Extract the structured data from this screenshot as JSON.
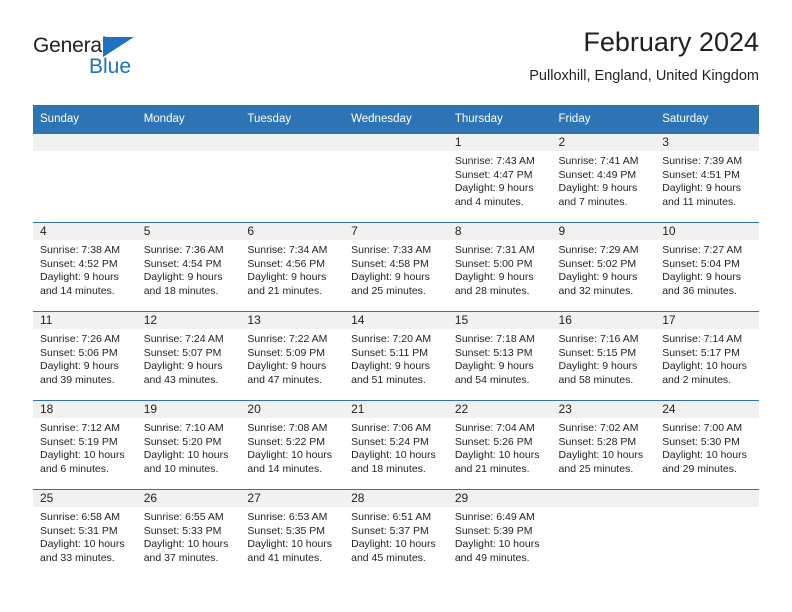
{
  "logo": {
    "word1": "General",
    "word2": "Blue",
    "triangle_color": "#1f72bd",
    "icon": "triangle-icon"
  },
  "header": {
    "title": "February 2024",
    "subtitle": "Pulloxhill, England, United Kingdom"
  },
  "theme": {
    "header_blue": "#2e74b5",
    "daynum_band": "#f1f1f1",
    "text": "#231f20"
  },
  "calendar": {
    "weekday_headers": [
      "Sunday",
      "Monday",
      "Tuesday",
      "Wednesday",
      "Thursday",
      "Friday",
      "Saturday"
    ],
    "weeks": [
      [
        {
          "day": "",
          "lines": []
        },
        {
          "day": "",
          "lines": []
        },
        {
          "day": "",
          "lines": []
        },
        {
          "day": "",
          "lines": []
        },
        {
          "day": "1",
          "lines": [
            "Sunrise: 7:43 AM",
            "Sunset: 4:47 PM",
            "Daylight: 9 hours",
            "and 4 minutes."
          ]
        },
        {
          "day": "2",
          "lines": [
            "Sunrise: 7:41 AM",
            "Sunset: 4:49 PM",
            "Daylight: 9 hours",
            "and 7 minutes."
          ]
        },
        {
          "day": "3",
          "lines": [
            "Sunrise: 7:39 AM",
            "Sunset: 4:51 PM",
            "Daylight: 9 hours",
            "and 11 minutes."
          ]
        }
      ],
      [
        {
          "day": "4",
          "lines": [
            "Sunrise: 7:38 AM",
            "Sunset: 4:52 PM",
            "Daylight: 9 hours",
            "and 14 minutes."
          ]
        },
        {
          "day": "5",
          "lines": [
            "Sunrise: 7:36 AM",
            "Sunset: 4:54 PM",
            "Daylight: 9 hours",
            "and 18 minutes."
          ]
        },
        {
          "day": "6",
          "lines": [
            "Sunrise: 7:34 AM",
            "Sunset: 4:56 PM",
            "Daylight: 9 hours",
            "and 21 minutes."
          ]
        },
        {
          "day": "7",
          "lines": [
            "Sunrise: 7:33 AM",
            "Sunset: 4:58 PM",
            "Daylight: 9 hours",
            "and 25 minutes."
          ]
        },
        {
          "day": "8",
          "lines": [
            "Sunrise: 7:31 AM",
            "Sunset: 5:00 PM",
            "Daylight: 9 hours",
            "and 28 minutes."
          ]
        },
        {
          "day": "9",
          "lines": [
            "Sunrise: 7:29 AM",
            "Sunset: 5:02 PM",
            "Daylight: 9 hours",
            "and 32 minutes."
          ]
        },
        {
          "day": "10",
          "lines": [
            "Sunrise: 7:27 AM",
            "Sunset: 5:04 PM",
            "Daylight: 9 hours",
            "and 36 minutes."
          ]
        }
      ],
      [
        {
          "day": "11",
          "lines": [
            "Sunrise: 7:26 AM",
            "Sunset: 5:06 PM",
            "Daylight: 9 hours",
            "and 39 minutes."
          ]
        },
        {
          "day": "12",
          "lines": [
            "Sunrise: 7:24 AM",
            "Sunset: 5:07 PM",
            "Daylight: 9 hours",
            "and 43 minutes."
          ]
        },
        {
          "day": "13",
          "lines": [
            "Sunrise: 7:22 AM",
            "Sunset: 5:09 PM",
            "Daylight: 9 hours",
            "and 47 minutes."
          ]
        },
        {
          "day": "14",
          "lines": [
            "Sunrise: 7:20 AM",
            "Sunset: 5:11 PM",
            "Daylight: 9 hours",
            "and 51 minutes."
          ]
        },
        {
          "day": "15",
          "lines": [
            "Sunrise: 7:18 AM",
            "Sunset: 5:13 PM",
            "Daylight: 9 hours",
            "and 54 minutes."
          ]
        },
        {
          "day": "16",
          "lines": [
            "Sunrise: 7:16 AM",
            "Sunset: 5:15 PM",
            "Daylight: 9 hours",
            "and 58 minutes."
          ]
        },
        {
          "day": "17",
          "lines": [
            "Sunrise: 7:14 AM",
            "Sunset: 5:17 PM",
            "Daylight: 10 hours",
            "and 2 minutes."
          ]
        }
      ],
      [
        {
          "day": "18",
          "lines": [
            "Sunrise: 7:12 AM",
            "Sunset: 5:19 PM",
            "Daylight: 10 hours",
            "and 6 minutes."
          ]
        },
        {
          "day": "19",
          "lines": [
            "Sunrise: 7:10 AM",
            "Sunset: 5:20 PM",
            "Daylight: 10 hours",
            "and 10 minutes."
          ]
        },
        {
          "day": "20",
          "lines": [
            "Sunrise: 7:08 AM",
            "Sunset: 5:22 PM",
            "Daylight: 10 hours",
            "and 14 minutes."
          ]
        },
        {
          "day": "21",
          "lines": [
            "Sunrise: 7:06 AM",
            "Sunset: 5:24 PM",
            "Daylight: 10 hours",
            "and 18 minutes."
          ]
        },
        {
          "day": "22",
          "lines": [
            "Sunrise: 7:04 AM",
            "Sunset: 5:26 PM",
            "Daylight: 10 hours",
            "and 21 minutes."
          ]
        },
        {
          "day": "23",
          "lines": [
            "Sunrise: 7:02 AM",
            "Sunset: 5:28 PM",
            "Daylight: 10 hours",
            "and 25 minutes."
          ]
        },
        {
          "day": "24",
          "lines": [
            "Sunrise: 7:00 AM",
            "Sunset: 5:30 PM",
            "Daylight: 10 hours",
            "and 29 minutes."
          ]
        }
      ],
      [
        {
          "day": "25",
          "lines": [
            "Sunrise: 6:58 AM",
            "Sunset: 5:31 PM",
            "Daylight: 10 hours",
            "and 33 minutes."
          ]
        },
        {
          "day": "26",
          "lines": [
            "Sunrise: 6:55 AM",
            "Sunset: 5:33 PM",
            "Daylight: 10 hours",
            "and 37 minutes."
          ]
        },
        {
          "day": "27",
          "lines": [
            "Sunrise: 6:53 AM",
            "Sunset: 5:35 PM",
            "Daylight: 10 hours",
            "and 41 minutes."
          ]
        },
        {
          "day": "28",
          "lines": [
            "Sunrise: 6:51 AM",
            "Sunset: 5:37 PM",
            "Daylight: 10 hours",
            "and 45 minutes."
          ]
        },
        {
          "day": "29",
          "lines": [
            "Sunrise: 6:49 AM",
            "Sunset: 5:39 PM",
            "Daylight: 10 hours",
            "and 49 minutes."
          ]
        },
        {
          "day": "",
          "lines": []
        },
        {
          "day": "",
          "lines": []
        }
      ]
    ]
  }
}
